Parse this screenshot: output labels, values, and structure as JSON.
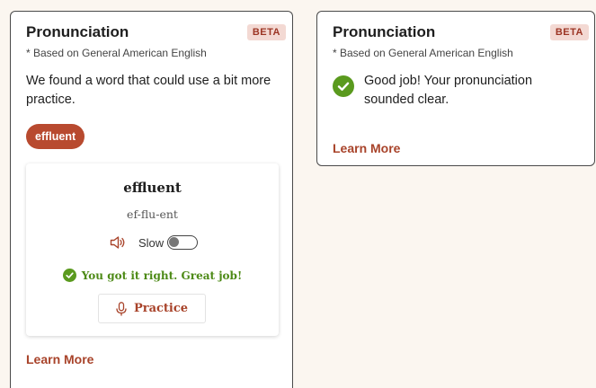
{
  "colors": {
    "accent": "#a8432a",
    "pill_bg": "#b84a2f",
    "success": "#4d8a16",
    "beta_bg": "#f3d9d3",
    "page_bg": "#fbf6f0"
  },
  "left_card": {
    "title": "Pronunciation",
    "badge": "BETA",
    "subtitle": "* Based on General American English",
    "message": "We found a word that could use a bit more practice.",
    "word_chip": "effluent",
    "word_panel": {
      "word": "effluent",
      "syllables": "ef-flu-ent",
      "speaker_icon": "speaker-icon",
      "slow_label": "Slow",
      "slow_toggle_on": false,
      "success_icon": "check-circle-icon",
      "success_text": "You got it right. Great job!",
      "practice_icon": "microphone-icon",
      "practice_label": "Practice"
    },
    "learn_more": "Learn More"
  },
  "right_card": {
    "title": "Pronunciation",
    "badge": "BETA",
    "subtitle": "* Based on General American English",
    "status_icon": "check-circle-icon",
    "message": "Good job! Your pronunciation sounded clear.",
    "learn_more": "Learn More"
  }
}
